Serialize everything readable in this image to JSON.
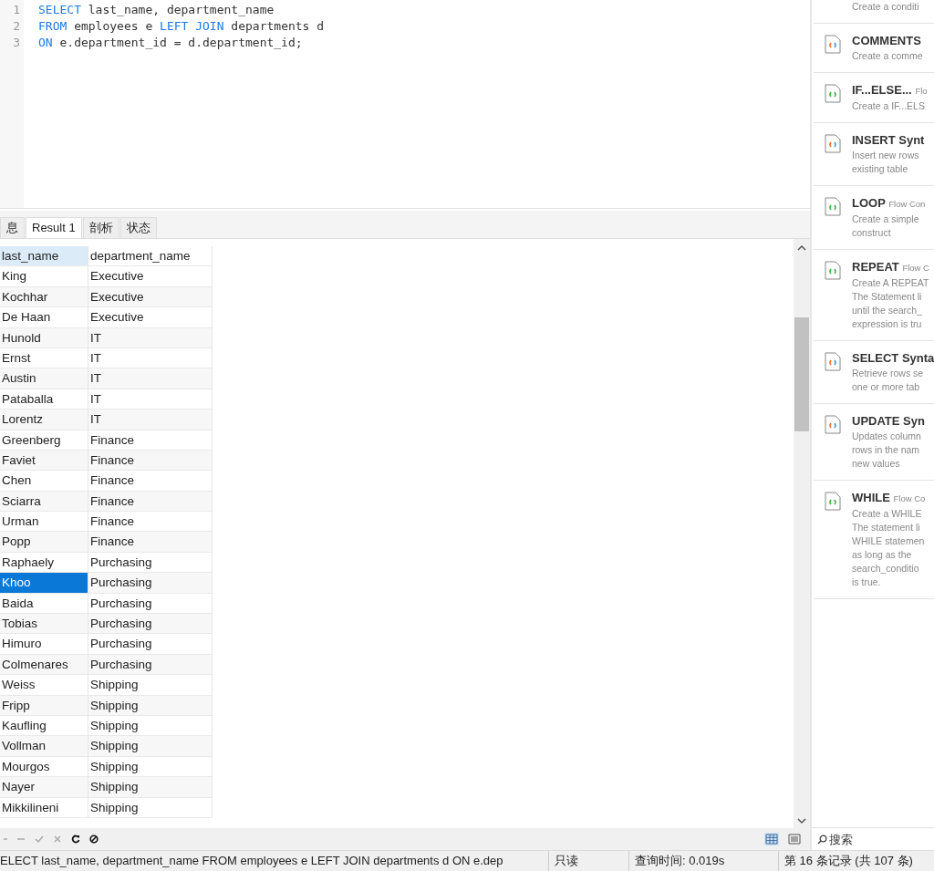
{
  "editor": {
    "lines": [
      {
        "number": "1",
        "tokens": [
          {
            "kind": "keyword",
            "text": "SELECT"
          },
          {
            "kind": "plain",
            "text": " last_name, department_name"
          }
        ]
      },
      {
        "number": "2",
        "tokens": [
          {
            "kind": "keyword",
            "text": "FROM"
          },
          {
            "kind": "plain",
            "text": " employees e "
          },
          {
            "kind": "keyword",
            "text": "LEFT JOIN"
          },
          {
            "kind": "plain",
            "text": " departments d"
          }
        ]
      },
      {
        "number": "3",
        "tokens": [
          {
            "kind": "keyword",
            "text": "ON"
          },
          {
            "kind": "plain",
            "text": " e.department_id = d.department_id;"
          }
        ]
      }
    ]
  },
  "tabs": [
    {
      "label": "息",
      "selected": false
    },
    {
      "label": "Result 1",
      "selected": true
    },
    {
      "label": "剖析",
      "selected": false
    },
    {
      "label": "状态",
      "selected": false
    }
  ],
  "table": {
    "columns": [
      {
        "label": "last_name",
        "selected": true
      },
      {
        "label": "department_name",
        "selected": false
      }
    ],
    "rows": [
      {
        "cells": [
          "King",
          "Executive"
        ],
        "selected": false
      },
      {
        "cells": [
          "Kochhar",
          "Executive"
        ],
        "selected": false
      },
      {
        "cells": [
          "De Haan",
          "Executive"
        ],
        "selected": false
      },
      {
        "cells": [
          "Hunold",
          "IT"
        ],
        "selected": false
      },
      {
        "cells": [
          "Ernst",
          "IT"
        ],
        "selected": false
      },
      {
        "cells": [
          "Austin",
          "IT"
        ],
        "selected": false
      },
      {
        "cells": [
          "Pataballa",
          "IT"
        ],
        "selected": false
      },
      {
        "cells": [
          "Lorentz",
          "IT"
        ],
        "selected": false
      },
      {
        "cells": [
          "Greenberg",
          "Finance"
        ],
        "selected": false
      },
      {
        "cells": [
          "Faviet",
          "Finance"
        ],
        "selected": false
      },
      {
        "cells": [
          "Chen",
          "Finance"
        ],
        "selected": false
      },
      {
        "cells": [
          "Sciarra",
          "Finance"
        ],
        "selected": false
      },
      {
        "cells": [
          "Urman",
          "Finance"
        ],
        "selected": false
      },
      {
        "cells": [
          "Popp",
          "Finance"
        ],
        "selected": false
      },
      {
        "cells": [
          "Raphaely",
          "Purchasing"
        ],
        "selected": false
      },
      {
        "cells": [
          "Khoo",
          "Purchasing"
        ],
        "selected": true
      },
      {
        "cells": [
          "Baida",
          "Purchasing"
        ],
        "selected": false
      },
      {
        "cells": [
          "Tobias",
          "Purchasing"
        ],
        "selected": false
      },
      {
        "cells": [
          "Himuro",
          "Purchasing"
        ],
        "selected": false
      },
      {
        "cells": [
          "Colmenares",
          "Purchasing"
        ],
        "selected": false
      },
      {
        "cells": [
          "Weiss",
          "Shipping"
        ],
        "selected": false
      },
      {
        "cells": [
          "Fripp",
          "Shipping"
        ],
        "selected": false
      },
      {
        "cells": [
          "Kaufling",
          "Shipping"
        ],
        "selected": false
      },
      {
        "cells": [
          "Vollman",
          "Shipping"
        ],
        "selected": false
      },
      {
        "cells": [
          "Mourgos",
          "Shipping"
        ],
        "selected": false
      },
      {
        "cells": [
          "Nayer",
          "Shipping"
        ],
        "selected": false
      },
      {
        "cells": [
          "Mikkilineni",
          "Shipping"
        ],
        "selected": false
      }
    ]
  },
  "snippets": [
    {
      "description": [
        "Create a conditi"
      ]
    },
    {
      "kind": "syntax",
      "title": "COMMENTS",
      "description": [
        "Create a comme"
      ]
    },
    {
      "kind": "flow",
      "title": "IF...ELSE...",
      "category": "Flo",
      "description": [
        "Create a IF...ELS"
      ]
    },
    {
      "kind": "syntax",
      "title": "INSERT Synt",
      "description": [
        "Insert new rows",
        "existing table"
      ]
    },
    {
      "kind": "flow",
      "title": "LOOP",
      "category": "Flow Con",
      "description": [
        "Create a simple",
        "construct"
      ]
    },
    {
      "kind": "flow",
      "title": "REPEAT",
      "category": "Flow C",
      "description": [
        "Create A REPEAT",
        "The Statement li",
        "until the search_",
        "expression is tru"
      ]
    },
    {
      "kind": "syntax",
      "title": "SELECT Synta",
      "description": [
        "Retrieve rows se",
        "one or more tab"
      ]
    },
    {
      "kind": "syntax",
      "title": "UPDATE Syn",
      "description": [
        "Updates column",
        "rows in the nam",
        "new values"
      ]
    },
    {
      "kind": "flow",
      "title": "WHILE",
      "category": "Flow Co",
      "description": [
        "Create a WHILE",
        "The statement li",
        "WHILE statemen",
        "as long as the",
        "search_conditio",
        "is true."
      ]
    }
  ],
  "search": {
    "placeholder": "搜索"
  },
  "status_bar": {
    "query": "ELECT last_name, department_name FROM employees e LEFT JOIN departments d ON e.dep",
    "mode": "只读",
    "time": "查询时间: 0.019s",
    "record": "第 16 条记录 (共 107 条)"
  }
}
